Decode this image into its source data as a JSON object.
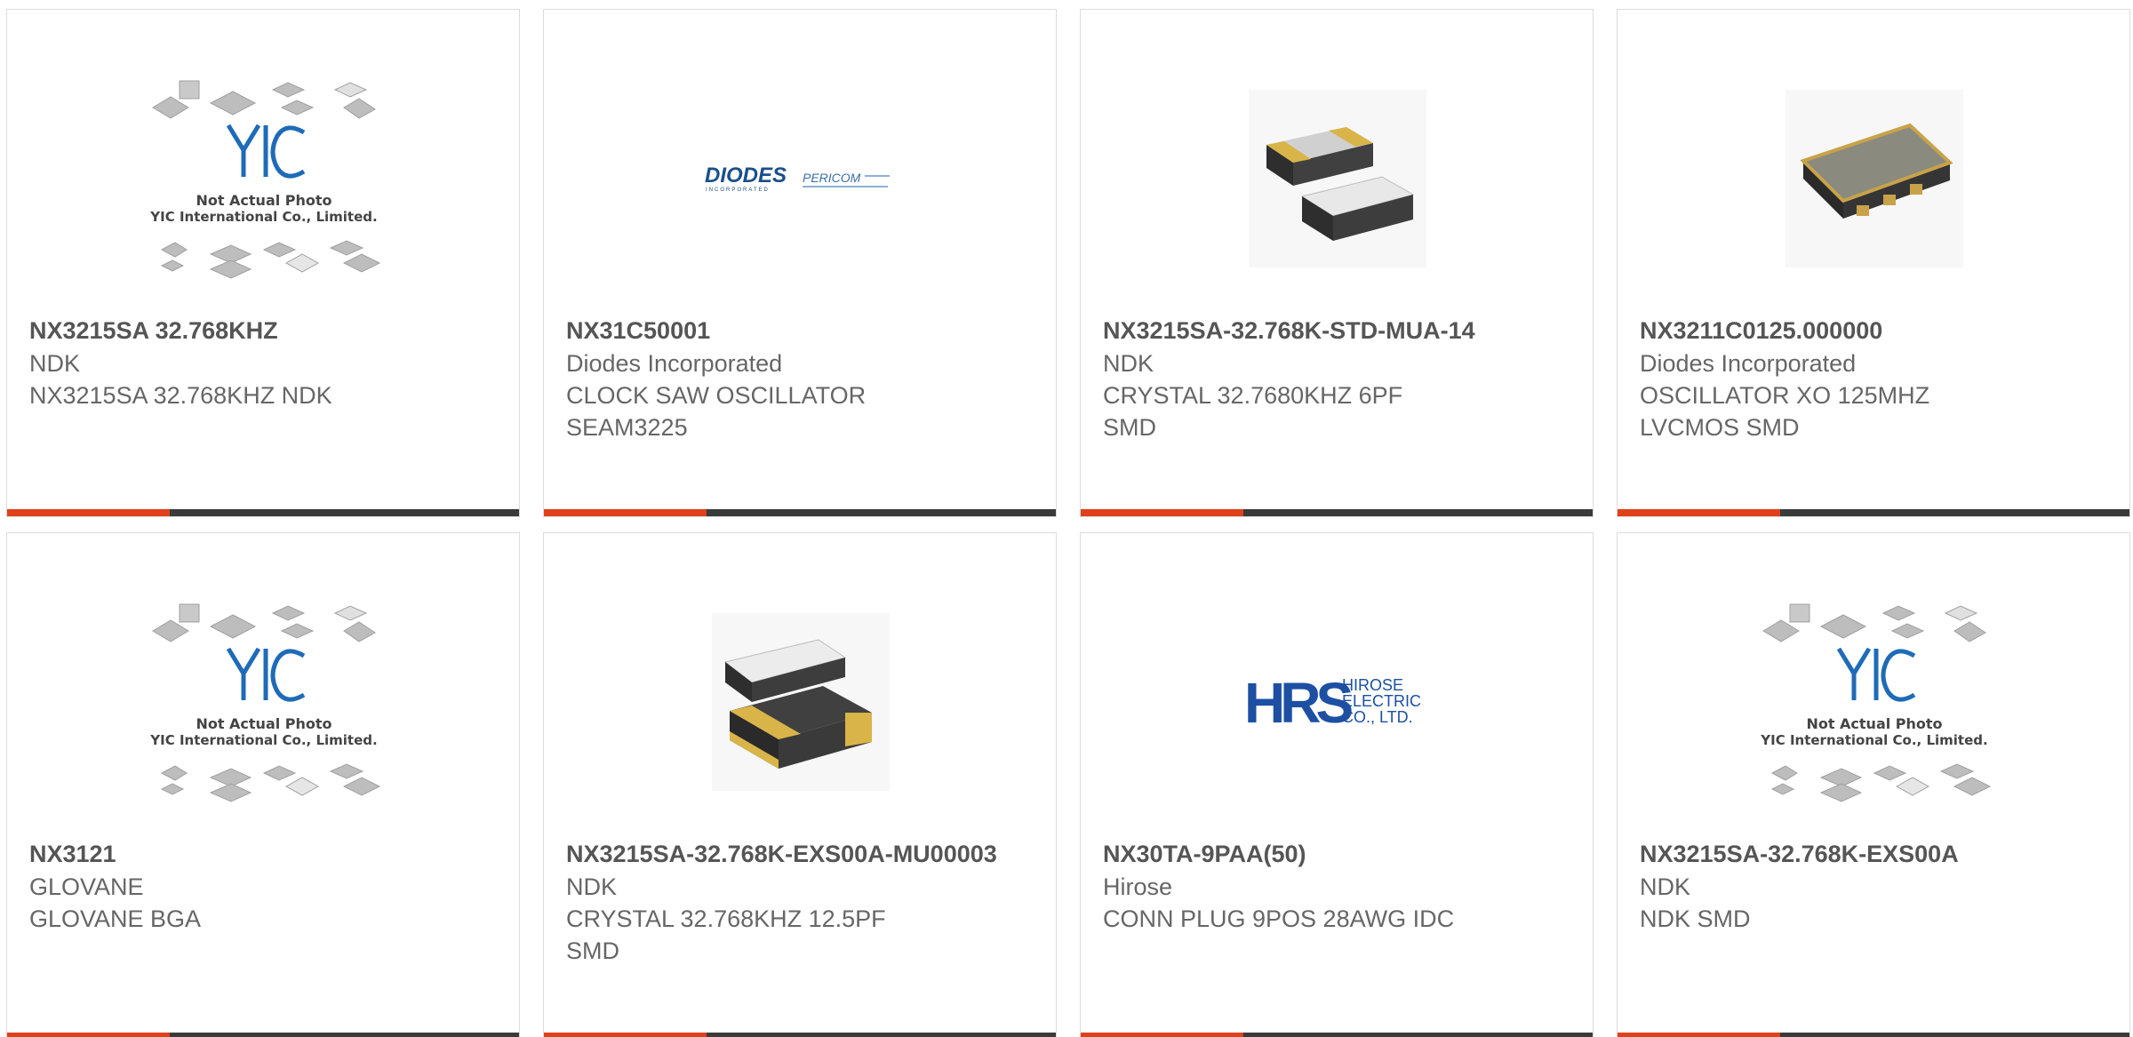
{
  "colors": {
    "accent": "#e0401a",
    "bar": "#3a3a3a",
    "text_strong": "#555555",
    "text": "#666666",
    "border": "#dcdcdc",
    "yic_blue": "#1e6bb8",
    "diodes_blue": "#1a4f8a",
    "hrs_blue": "#1d4fa3"
  },
  "placeholder": {
    "logo": "YIC",
    "line1": "Not Actual Photo",
    "line2": "YIC International Co., Limited."
  },
  "brand_logos": {
    "diodes": "DIODES",
    "diodes_sub": "INCORPORATED",
    "pericom": "PERICOM",
    "hrs": "HRS",
    "hirose_1": "HIROSE",
    "hirose_2": "ELECTRIC",
    "hirose_3": "CO., LTD."
  },
  "products": [
    {
      "part": "NX3215SA 32.768KHZ",
      "manufacturer": "NDK",
      "desc1": "NX3215SA 32.768KHZ NDK",
      "desc2": "",
      "image": "placeholder-photo-icon"
    },
    {
      "part": "NX31C50001",
      "manufacturer": "Diodes Incorporated",
      "desc1": "CLOCK SAW OSCILLATOR",
      "desc2": "SEAM3225",
      "image": "diodes-logo-icon"
    },
    {
      "part": "NX3215SA-32.768K-STD-MUA-14",
      "manufacturer": "NDK",
      "desc1": "CRYSTAL 32.7680KHZ 6PF",
      "desc2": "SMD",
      "image": "crystal-chip-icon"
    },
    {
      "part": "NX3211C0125.000000",
      "manufacturer": "Diodes Incorporated",
      "desc1": "OSCILLATOR XO 125MHZ",
      "desc2": "LVCMOS SMD",
      "image": "oscillator-chip-icon"
    },
    {
      "part": "NX3121",
      "manufacturer": "GLOVANE",
      "desc1": "GLOVANE BGA",
      "desc2": "",
      "image": "placeholder-photo-icon"
    },
    {
      "part": "NX3215SA-32.768K-EXS00A-MU00003",
      "manufacturer": "NDK",
      "desc1": "CRYSTAL 32.768KHZ 12.5PF",
      "desc2": "SMD",
      "image": "crystal-chip-icon"
    },
    {
      "part": "NX30TA-9PAA(50)",
      "manufacturer": "Hirose",
      "desc1": "CONN PLUG 9POS 28AWG IDC",
      "desc2": "",
      "image": "hirose-logo-icon"
    },
    {
      "part": "NX3215SA-32.768K-EXS00A",
      "manufacturer": "NDK",
      "desc1": "NDK SMD",
      "desc2": "",
      "image": "placeholder-photo-icon"
    }
  ]
}
